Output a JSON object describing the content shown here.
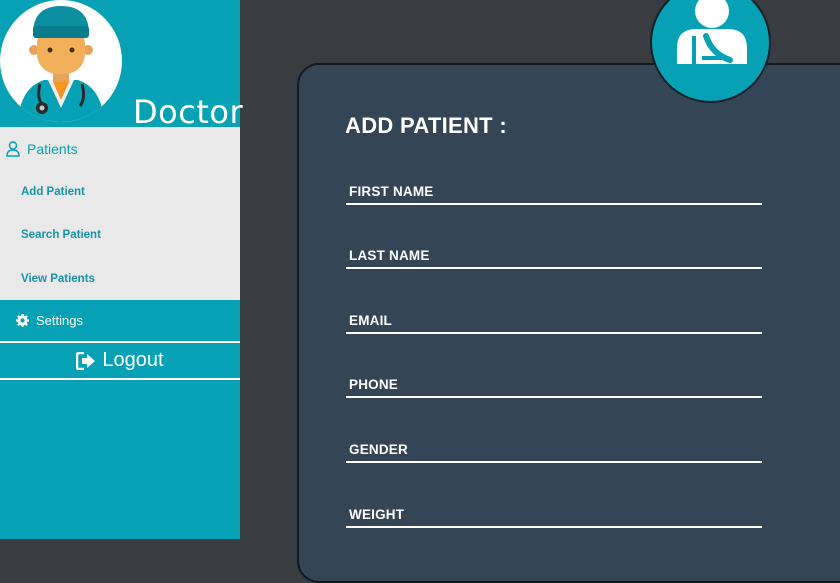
{
  "sidebar": {
    "role_title": "Doctor",
    "menu": {
      "section_label": "Patients",
      "items": [
        {
          "label": "Add Patient"
        },
        {
          "label": "Search Patient"
        },
        {
          "label": "View Patients"
        }
      ]
    },
    "settings_label": "Settings",
    "logout_label": "Logout"
  },
  "form": {
    "title": "ADD PATIENT :",
    "fields": [
      {
        "label": "FIRST NAME"
      },
      {
        "label": "LAST NAME"
      },
      {
        "label": "EMAIL"
      },
      {
        "label": "PHONE"
      },
      {
        "label": "GENDER"
      },
      {
        "label": "WEIGHT"
      }
    ]
  },
  "colors": {
    "accent": "#06a1b5",
    "background": "#393d42",
    "card": "#344556",
    "menu_panel": "#e9e9e9"
  },
  "icons": [
    "doctor-avatar-icon",
    "user-icon",
    "gear-icon",
    "sign-out-icon",
    "patient-badge-icon"
  ]
}
